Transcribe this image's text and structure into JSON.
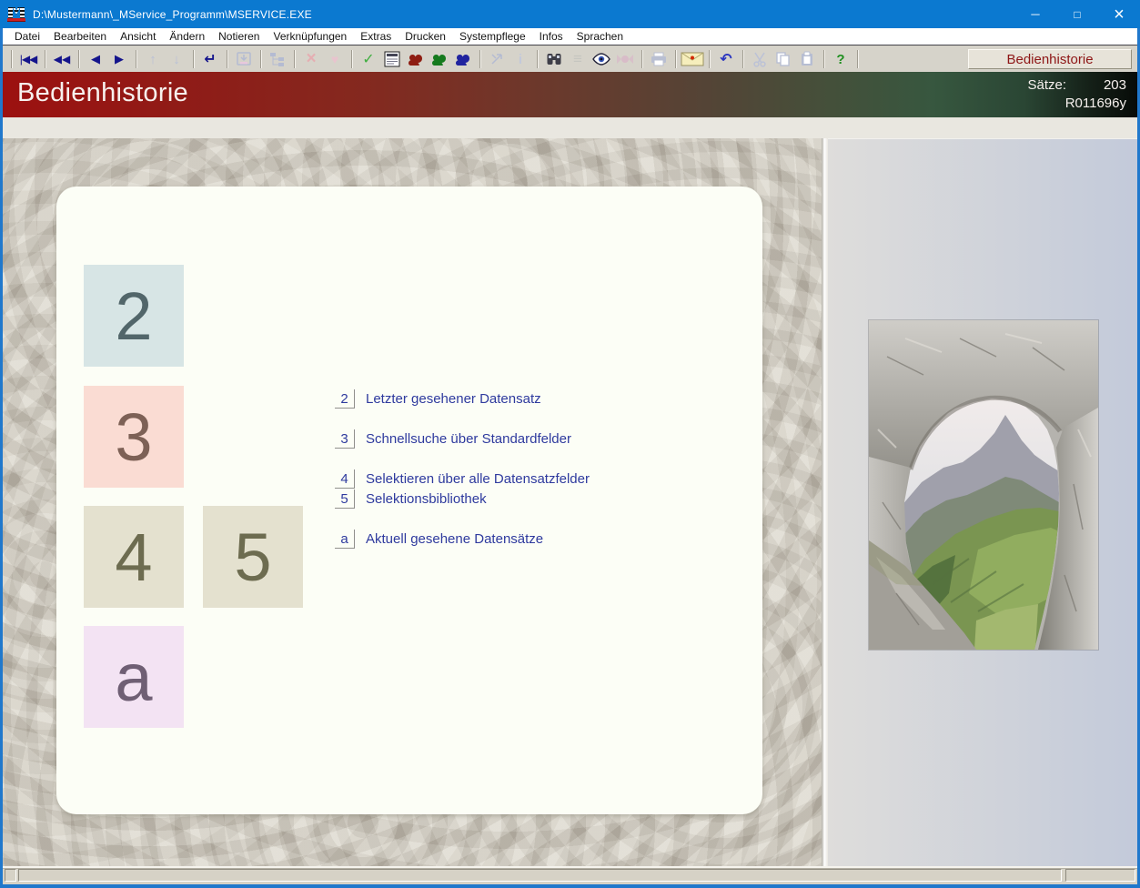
{
  "window": {
    "title": "D:\\Mustermann\\_MService_Programm\\MSERVICE.EXE",
    "minimize_glyph": "─",
    "maximize_glyph": "□",
    "close_glyph": "×"
  },
  "menu": {
    "items": [
      {
        "id": "datei",
        "label": "Datei"
      },
      {
        "id": "bearbeiten",
        "label": "Bearbeiten"
      },
      {
        "id": "ansicht",
        "label": "Ansicht"
      },
      {
        "id": "aendern",
        "label": "Ändern"
      },
      {
        "id": "notieren",
        "label": "Notieren"
      },
      {
        "id": "verknuepfungen",
        "label": "Verknüpfungen"
      },
      {
        "id": "extras",
        "label": "Extras"
      },
      {
        "id": "drucken",
        "label": "Drucken"
      },
      {
        "id": "systempflege",
        "label": "Systempflege"
      },
      {
        "id": "infos",
        "label": "Infos"
      },
      {
        "id": "sprachen",
        "label": "Sprachen"
      }
    ]
  },
  "toolbar": {
    "context_label": "Bedienhistorie",
    "context_color": "#8e1616",
    "icons": [
      {
        "separator": true
      },
      {
        "name": "first-record-button",
        "type": "glyph",
        "glyph": "|◀◀",
        "color": "#14148c",
        "size": 12
      },
      {
        "separator": true
      },
      {
        "name": "rewind-button",
        "type": "glyph",
        "glyph": "◀◀",
        "color": "#14148c",
        "size": 12
      },
      {
        "separator": true
      },
      {
        "name": "previous-button",
        "type": "glyph",
        "glyph": "◀",
        "color": "#14148c",
        "size": 13
      },
      {
        "name": "next-button",
        "type": "glyph",
        "glyph": "▶",
        "color": "#14148c",
        "size": 13
      },
      {
        "separator": true
      },
      {
        "name": "up-button",
        "type": "glyph",
        "glyph": "↑",
        "color": "#b9c0d6",
        "size": 15,
        "bold": true
      },
      {
        "name": "down-button",
        "type": "glyph",
        "glyph": "↓",
        "color": "#b9c0d6",
        "size": 15,
        "bold": true
      },
      {
        "separator": true
      },
      {
        "name": "enter-button",
        "type": "glyph",
        "glyph": "↵",
        "color": "#14148c",
        "size": 16,
        "bold": true
      },
      {
        "separator": true
      },
      {
        "name": "import-button",
        "type": "svg",
        "icon": "tray",
        "color": "#b4bbd2"
      },
      {
        "separator": true
      },
      {
        "name": "tree-button",
        "type": "svg",
        "icon": "tree",
        "color": "#b4bbd2"
      },
      {
        "separator": true
      },
      {
        "name": "delete-button",
        "type": "glyph",
        "glyph": "×",
        "color": "#e5aeb2",
        "size": 19,
        "bold": true
      },
      {
        "name": "favorite-button",
        "type": "glyph",
        "glyph": "♥",
        "color": "#e8c4ce",
        "size": 14
      },
      {
        "separator": true
      },
      {
        "name": "confirm-button",
        "type": "glyph",
        "glyph": "✓",
        "color": "#3fae3f",
        "size": 16,
        "bold": true
      },
      {
        "name": "form-button",
        "type": "svg",
        "icon": "form",
        "color": "#333344"
      },
      {
        "name": "squirrel-red-button",
        "type": "svg",
        "icon": "squirrel",
        "color": "#8e1d12"
      },
      {
        "name": "squirrel-green-button",
        "type": "svg",
        "icon": "squirrel",
        "color": "#157a1e"
      },
      {
        "name": "squirrel-blue-button",
        "type": "svg",
        "icon": "squirrel",
        "color": "#20239f"
      },
      {
        "separator": true
      },
      {
        "name": "branch-button",
        "type": "svg",
        "icon": "branch",
        "color": "#b4bbd2"
      },
      {
        "name": "info-button",
        "type": "glyph",
        "glyph": "i",
        "color": "#c3c9da",
        "size": 15,
        "bold": true
      },
      {
        "separator": true
      },
      {
        "name": "search-button",
        "type": "svg",
        "icon": "binoculars",
        "color": "#3e3e48"
      },
      {
        "name": "list-button",
        "type": "glyph",
        "glyph": "≡",
        "color": "#c6c6c0",
        "size": 17,
        "bold": true
      },
      {
        "name": "view-button",
        "type": "svg",
        "icon": "eye",
        "color": "#23233a"
      },
      {
        "name": "candy-button",
        "type": "svg",
        "icon": "candy",
        "color": "#d8bcc8"
      },
      {
        "separator": true
      },
      {
        "name": "print-button",
        "type": "svg",
        "icon": "printer",
        "color": "#b9bfd2"
      },
      {
        "separator": true
      },
      {
        "name": "mail-button",
        "type": "svg",
        "icon": "envelope",
        "color": "#9a9160"
      },
      {
        "separator": true
      },
      {
        "name": "undo-button",
        "type": "glyph",
        "glyph": "↶",
        "color": "#2a35c0",
        "size": 16,
        "bold": true
      },
      {
        "separator": true
      },
      {
        "name": "cut-button",
        "type": "svg",
        "icon": "scissors",
        "color": "#bcc2d6"
      },
      {
        "name": "copy-button",
        "type": "svg",
        "icon": "copy",
        "color": "#b6bdd2"
      },
      {
        "name": "paste-button",
        "type": "svg",
        "icon": "paste",
        "color": "#b6bdd2"
      },
      {
        "separator": true
      },
      {
        "name": "help-button",
        "type": "glyph",
        "glyph": "?",
        "color": "#1f8f1f",
        "size": 15,
        "bold": true
      },
      {
        "separator": true
      }
    ]
  },
  "banner": {
    "title": "Bedienhistorie",
    "records_label": "Sätze:",
    "records_value": "203",
    "record_code": "R011696y"
  },
  "shortcuts": [
    {
      "key": "2",
      "description": "Letzter gesehener Datensatz",
      "tile_bg": "#d7e5e5",
      "tile_fg": "#52666a"
    },
    {
      "key": "3",
      "description": "Schnellsuche über Standardfelder",
      "tile_bg": "#fadcd3",
      "tile_fg": "#7d6156"
    },
    {
      "key": "4",
      "description": "Selektieren über alle Datensatzfelder",
      "tile_bg": "#e4e1cf",
      "tile_fg": "#6d6c50"
    },
    {
      "key": "5",
      "description": "Selektionsbibliothek",
      "tile_bg": "#e4e1cf",
      "tile_fg": "#6d6c50"
    },
    {
      "key": "a",
      "description": "Aktuell gesehene Datensätze",
      "tile_bg": "#f3e3f3",
      "tile_fg": "#6f5f74"
    }
  ],
  "colors": {
    "titlebar": "#0b79d0",
    "accent_border": "#2078cc",
    "legend_text": "#2e3a9e"
  }
}
